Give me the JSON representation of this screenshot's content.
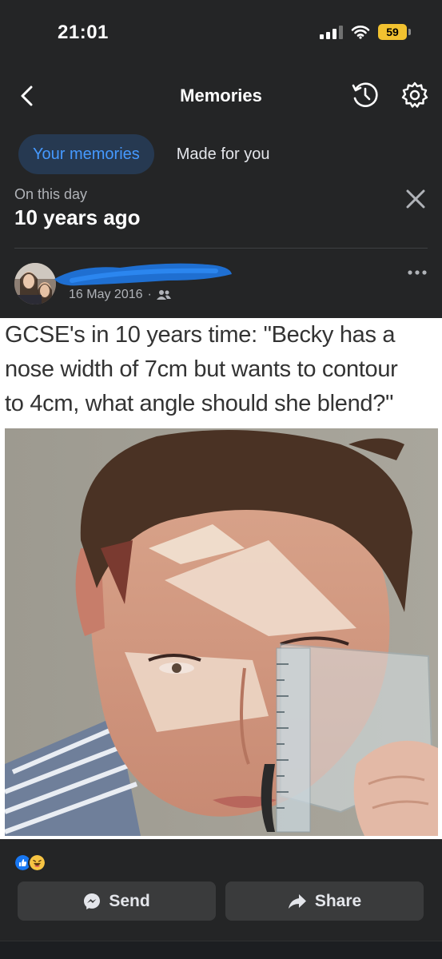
{
  "status_bar": {
    "time": "21:01",
    "battery": "59"
  },
  "nav": {
    "title": "Memories",
    "back_icon": "chevron-left-icon",
    "history_icon": "history-icon",
    "settings_icon": "gear-icon"
  },
  "tabs": [
    {
      "label": "Your memories",
      "active": true
    },
    {
      "label": "Made for you",
      "active": false
    }
  ],
  "on_this_day": {
    "label": "On this day",
    "years": "10 years ago"
  },
  "post": {
    "date": "16 May 2016",
    "audience_icon": "friends-icon",
    "caption_lines": [
      "GCSE's in 10 years time: \"Becky has a",
      "nose width of 7cm but wants to contour",
      "to 4cm, what angle should she blend?\""
    ]
  },
  "reactions": [
    "like-icon",
    "haha-icon"
  ],
  "actions": {
    "send": "Send",
    "share": "Share"
  },
  "colors": {
    "background": "#242526",
    "accent": "#4599ff",
    "tab_active_bg": "#263951",
    "button_bg": "#3a3b3c"
  }
}
